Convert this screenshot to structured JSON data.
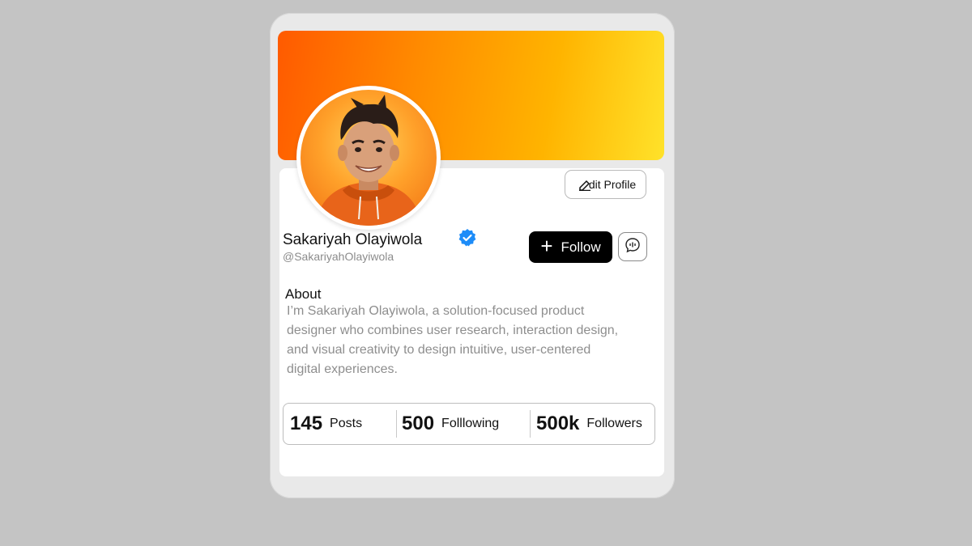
{
  "profile": {
    "name": "Sakariyah Olayiwola",
    "handle": "@SakariyahOlayiwola",
    "verified_icon": "verified-badge-icon",
    "edit_label": "dit Profile",
    "follow_label": "Follow",
    "about_title": "About",
    "about_text": "I’m Sakariyah Olayiwola, a solution-focused product designer who combines user research, interaction design, and visual creativity to design intuitive, user-centered digital experiences."
  },
  "stats": [
    {
      "value": "145",
      "label": "Posts"
    },
    {
      "value": "500",
      "label": "Folllowing"
    },
    {
      "value": "500k",
      "label": "Followers"
    }
  ],
  "colors": {
    "banner_start": "#ff5a00",
    "banner_end": "#ffe22a",
    "verified": "#1d8cf8",
    "follow_bg": "#000000"
  }
}
